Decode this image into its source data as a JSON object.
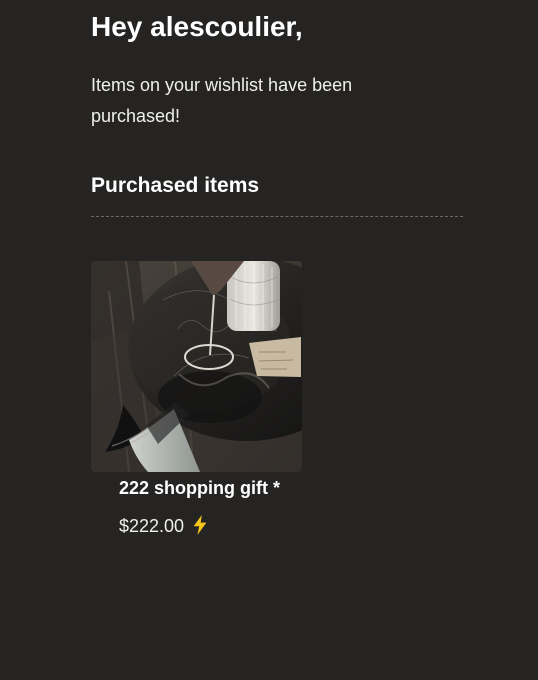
{
  "email": {
    "greeting": "Hey alescoulier,",
    "intro": "Items on your wishlist have been purchased!",
    "section_title": "Purchased items"
  },
  "purchased_items": [
    {
      "name": "222 shopping gift *",
      "price": "$222.00",
      "badge_icon": "lightning-icon"
    }
  ],
  "colors": {
    "background": "#252423",
    "text": "#f4f4f2",
    "divider": "#6b6966",
    "lightning": "#f5c518"
  }
}
